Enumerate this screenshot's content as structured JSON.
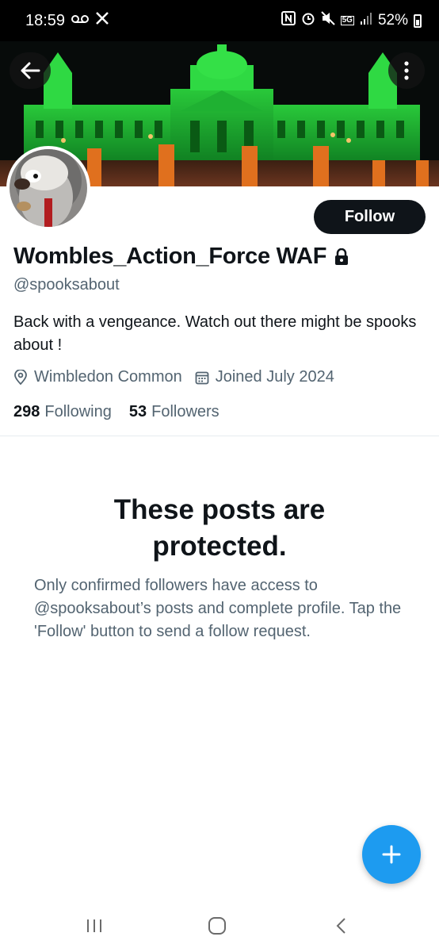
{
  "status_bar": {
    "time": "18:59",
    "left_icons": [
      "voicemail-icon",
      "x-app-icon"
    ],
    "right_icons": [
      "nfc-icon",
      "alarm-icon",
      "mute-icon",
      "5g-icon",
      "signal-icon"
    ],
    "network_label": "5G",
    "battery_percent": "52%"
  },
  "header": {
    "back_icon": "arrow-left-icon",
    "more_icon": "more-vertical-icon"
  },
  "profile": {
    "display_name": "Wombles_Action_Force WAF",
    "locked_icon": "lock-icon",
    "handle": "@spooksabout",
    "bio": "Back with a vengeance. Watch out there might be spooks about !",
    "location": "Wimbledon Common",
    "joined": "Joined July 2024",
    "following_count": "298",
    "following_label": "Following",
    "followers_count": "53",
    "followers_label": "Followers",
    "follow_button": "Follow"
  },
  "protected": {
    "title": "These posts are protected.",
    "body": "Only confirmed followers have access to @spooksabout’s posts and complete profile. Tap the 'Follow' button to send a follow request."
  },
  "fab": {
    "icon": "plus-icon"
  },
  "nav": {
    "icons": [
      "recents-icon",
      "home-icon",
      "back-icon"
    ]
  },
  "colors": {
    "accent": "#1d9bf0",
    "text_primary": "#0f1419",
    "text_secondary": "#536471",
    "banner_glow": "#2bd63a"
  }
}
